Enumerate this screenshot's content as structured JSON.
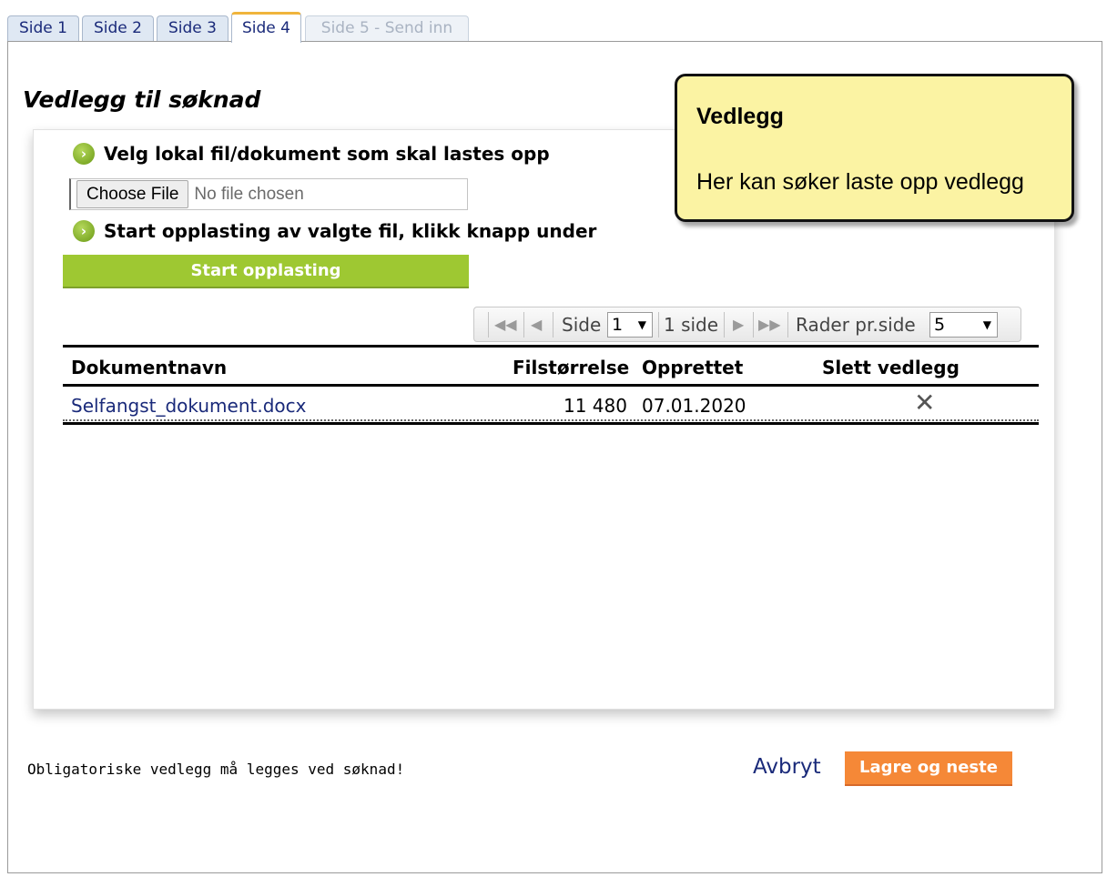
{
  "tabs": [
    {
      "label": "Side 1"
    },
    {
      "label": "Side 2"
    },
    {
      "label": "Side 3"
    },
    {
      "label": "Side 4"
    },
    {
      "label": "Side 5 - Send inn"
    }
  ],
  "active_tab": "Side 4",
  "page_title": "Vedlegg til søknad",
  "upload": {
    "step1": "Velg lokal fil/dokument som skal lastes opp",
    "choose_file": "Choose File",
    "no_file": "No file chosen",
    "step2": "Start opplasting av valgte fil, klikk knapp under",
    "start_button": "Start opplasting"
  },
  "pager": {
    "side_label": "Side",
    "page_value": "1",
    "page_count": "1 side",
    "rows_label": "Rader pr.side",
    "rows_value": "5"
  },
  "table": {
    "headers": [
      "Dokumentnavn",
      "Filstørrelse",
      "Opprettet",
      "Slett vedlegg"
    ],
    "rows": [
      {
        "name": "Selfangst_dokument.docx",
        "size": "11 480",
        "created": "07.01.2020"
      }
    ]
  },
  "tooltip": {
    "title": "Vedlegg",
    "text": "Her kan søker laste opp vedlegg"
  },
  "footer": {
    "note": "Obligatoriske vedlegg må legges ved søknad!",
    "cancel": "Avbryt",
    "save": "Lagre og neste"
  },
  "colors": {
    "tab_accent": "#f0b43c",
    "upload_button": "#9ec832",
    "save_button": "#f58837",
    "link": "#1a2a7a",
    "tooltip_bg": "#fbf3a3"
  }
}
